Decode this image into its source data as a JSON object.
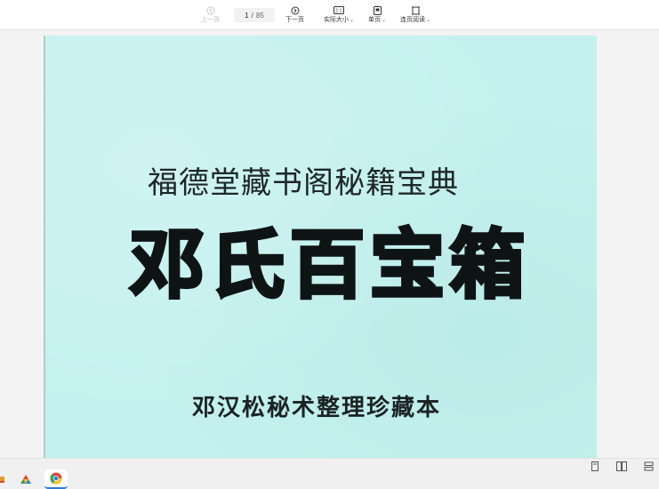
{
  "toolbar": {
    "prev_label": "上一页",
    "page_current": "1",
    "page_separator": "/",
    "page_total": "85",
    "next_label": "下一页",
    "actual_size_label": "实际大小",
    "single_page_label": "单页",
    "continuous_label": "连页阅读"
  },
  "document": {
    "subtitle": "福德堂藏书阁秘籍宝典",
    "title": "邓氏百宝箱",
    "footer": "邓汉松秘术整理珍藏本"
  },
  "colors": {
    "page_background": "#c4f1ef",
    "toolbar_background": "#ffffff",
    "viewport_background": "#f3f3f3"
  },
  "icons": {
    "prev": "prev-page-icon",
    "next": "next-page-icon",
    "actual_size": "actual-size-icon",
    "single_page": "single-page-icon",
    "continuous": "continuous-reading-icon"
  }
}
